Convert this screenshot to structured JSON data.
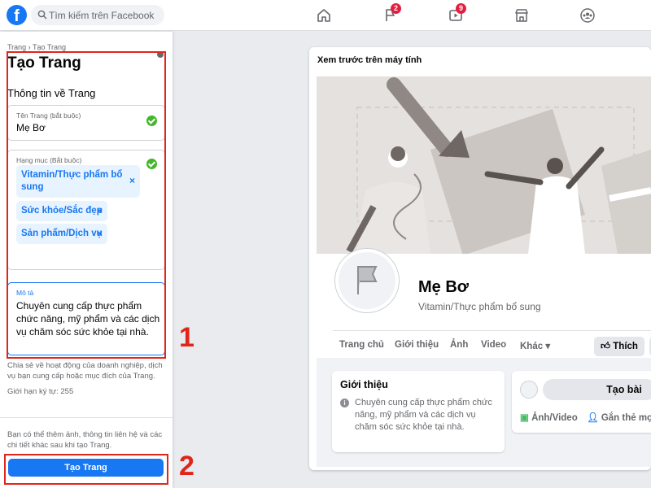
{
  "topbar": {
    "logo": "f",
    "search_placeholder": "Tìm kiếm trên Facebook",
    "nav": [
      {
        "icon": "home-icon",
        "badge": ""
      },
      {
        "icon": "flag-icon",
        "badge": "2"
      },
      {
        "icon": "watch-icon",
        "badge": "9"
      },
      {
        "icon": "marketplace-icon",
        "badge": ""
      },
      {
        "icon": "groups-icon",
        "badge": ""
      }
    ]
  },
  "sidebar": {
    "breadcrumb": "Trang › Tạo Trang",
    "title": "Tạo Trang",
    "section_title": "Thông tin về Trang",
    "name_field": {
      "label": "Tên Trang (bắt buộc)",
      "value": "Mẹ Bơ"
    },
    "category_field": {
      "label": "Hạng mục (Bắt buộc)",
      "chips": [
        "Vitamin/Thực phẩm bổ sung",
        "Sức khỏe/Sắc đẹp",
        "Sản phẩm/Dịch vụ"
      ],
      "remove_glyph": "×"
    },
    "description_field": {
      "label": "Mô tả",
      "value": "Chuyên cung cấp thực phẩm chức năng, mỹ phẩm và các dịch vụ chăm sóc sức khỏe tại nhà."
    },
    "help_text": "Chia sẻ về hoạt động của doanh nghiệp, dịch vụ bạn cung cấp hoặc mục đích của Trang.",
    "char_limit": "Giới hạn ký tự: 255",
    "footer_note": "Bạn có thể thêm ảnh, thông tin liên hệ và các chi tiết khác sau khi tạo Trang.",
    "create_button": "Tạo Trang"
  },
  "annotations": {
    "one": "1",
    "two": "2",
    "color": "#e0261b"
  },
  "preview": {
    "title": "Xem trước trên máy tính",
    "page_name": "Mẹ Bơ",
    "page_category": "Vitamin/Thực phẩm bổ sung",
    "tabs": [
      "Trang chủ",
      "Giới thiệu",
      "Ảnh",
      "Video",
      "Khác ▾"
    ],
    "like_button": "Thích",
    "intro": {
      "title": "Giới thiệu",
      "text": "Chuyên cung cấp thực phẩm chức năng, mỹ phẩm và các dịch vụ chăm sóc sức khỏe tại nhà."
    },
    "post": {
      "create": "Tạo bài",
      "photo_video": "Ảnh/Video",
      "tag": "Gắn thẻ mọ"
    }
  },
  "colors": {
    "brand": "#1877f2",
    "success": "#42b72a",
    "badge": "#e41e3f"
  }
}
